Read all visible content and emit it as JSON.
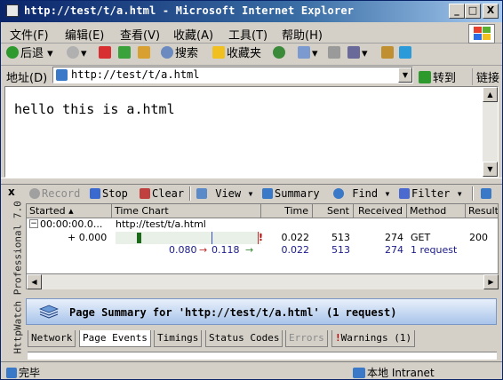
{
  "window": {
    "title": "http://test/t/a.html - Microsoft Internet Explorer",
    "min": "_",
    "max": "□",
    "close": "X"
  },
  "menu": [
    "文件(F)",
    "编辑(E)",
    "查看(V)",
    "收藏(A)",
    "工具(T)",
    "帮助(H)"
  ],
  "toolbar": {
    "back": "后退",
    "search": "搜索",
    "favorites": "收藏夹"
  },
  "address": {
    "label": "地址(D)",
    "value": "http://test/t/a.html",
    "go": "转到",
    "links": "链接"
  },
  "page": {
    "text": "hello this is a.html"
  },
  "httpwatch": {
    "close": "x",
    "vertical_title": "HttpWatch Professional 7.0",
    "toolbar": {
      "record": "Record",
      "stop": "Stop",
      "clear": "Clear",
      "view": "View",
      "summary": "Summary",
      "find": "Find",
      "filter": "Filter"
    },
    "columns": [
      "Started",
      "Time Chart",
      "Time",
      "Sent",
      "Received",
      "Method",
      "Result"
    ],
    "page_row": {
      "started": "00:00:00.0...",
      "url": "http://test/t/a.html"
    },
    "entry_row": {
      "started": "+ 0.000",
      "time": "0.022",
      "sent": "513",
      "received": "274",
      "method": "GET",
      "result": "200"
    },
    "total_row": {
      "t1": "0.080",
      "t2": "0.118",
      "time": "0.022",
      "sent": "513",
      "received": "274",
      "method": "1 request"
    },
    "summary": "Page Summary for 'http://test/t/a.html' (1 request)",
    "tabs": [
      "Network",
      "Page Events",
      "Timings",
      "Status Codes",
      "Errors",
      "Warnings (1)"
    ]
  },
  "status": {
    "left": "完毕",
    "zone": "本地 Intranet"
  }
}
